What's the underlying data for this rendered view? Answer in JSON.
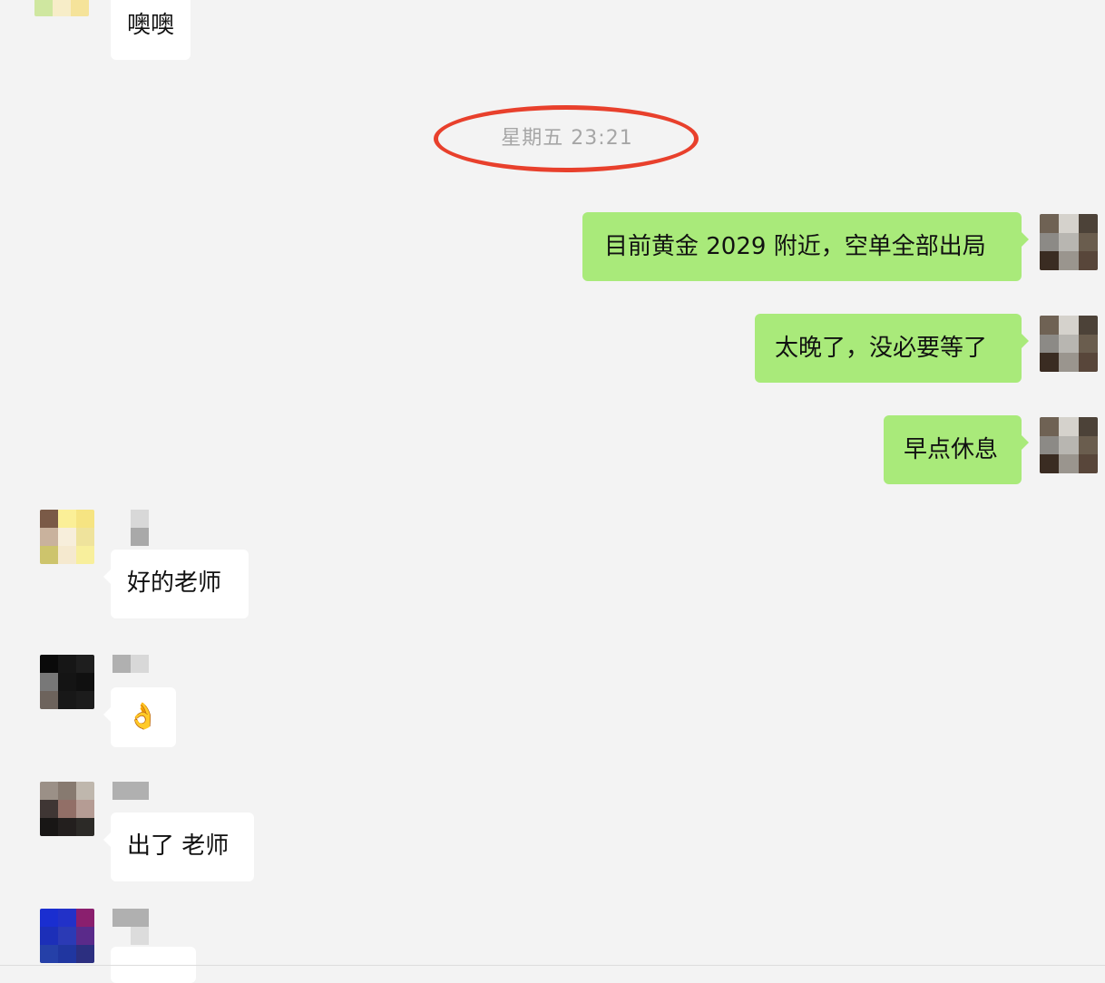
{
  "timestamp": "星期五 23:21",
  "messages": [
    {
      "side": "in",
      "text": "噢噢"
    },
    {
      "side": "out",
      "text": "目前黄金 2029 附近，空单全部出局"
    },
    {
      "side": "out",
      "text": "太晚了，没必要等了"
    },
    {
      "side": "out",
      "text": "早点休息"
    },
    {
      "side": "in",
      "text": "好的老师"
    },
    {
      "side": "in",
      "text": "👌"
    },
    {
      "side": "in",
      "text": "出了 老师"
    },
    {
      "side": "in",
      "text": ""
    }
  ],
  "colors": {
    "background": "#f3f3f3",
    "incoming_bubble": "#ffffff",
    "outgoing_bubble": "#a9ea7a",
    "highlight": "#e8402c",
    "timestamp_text": "#a6a6a6"
  }
}
